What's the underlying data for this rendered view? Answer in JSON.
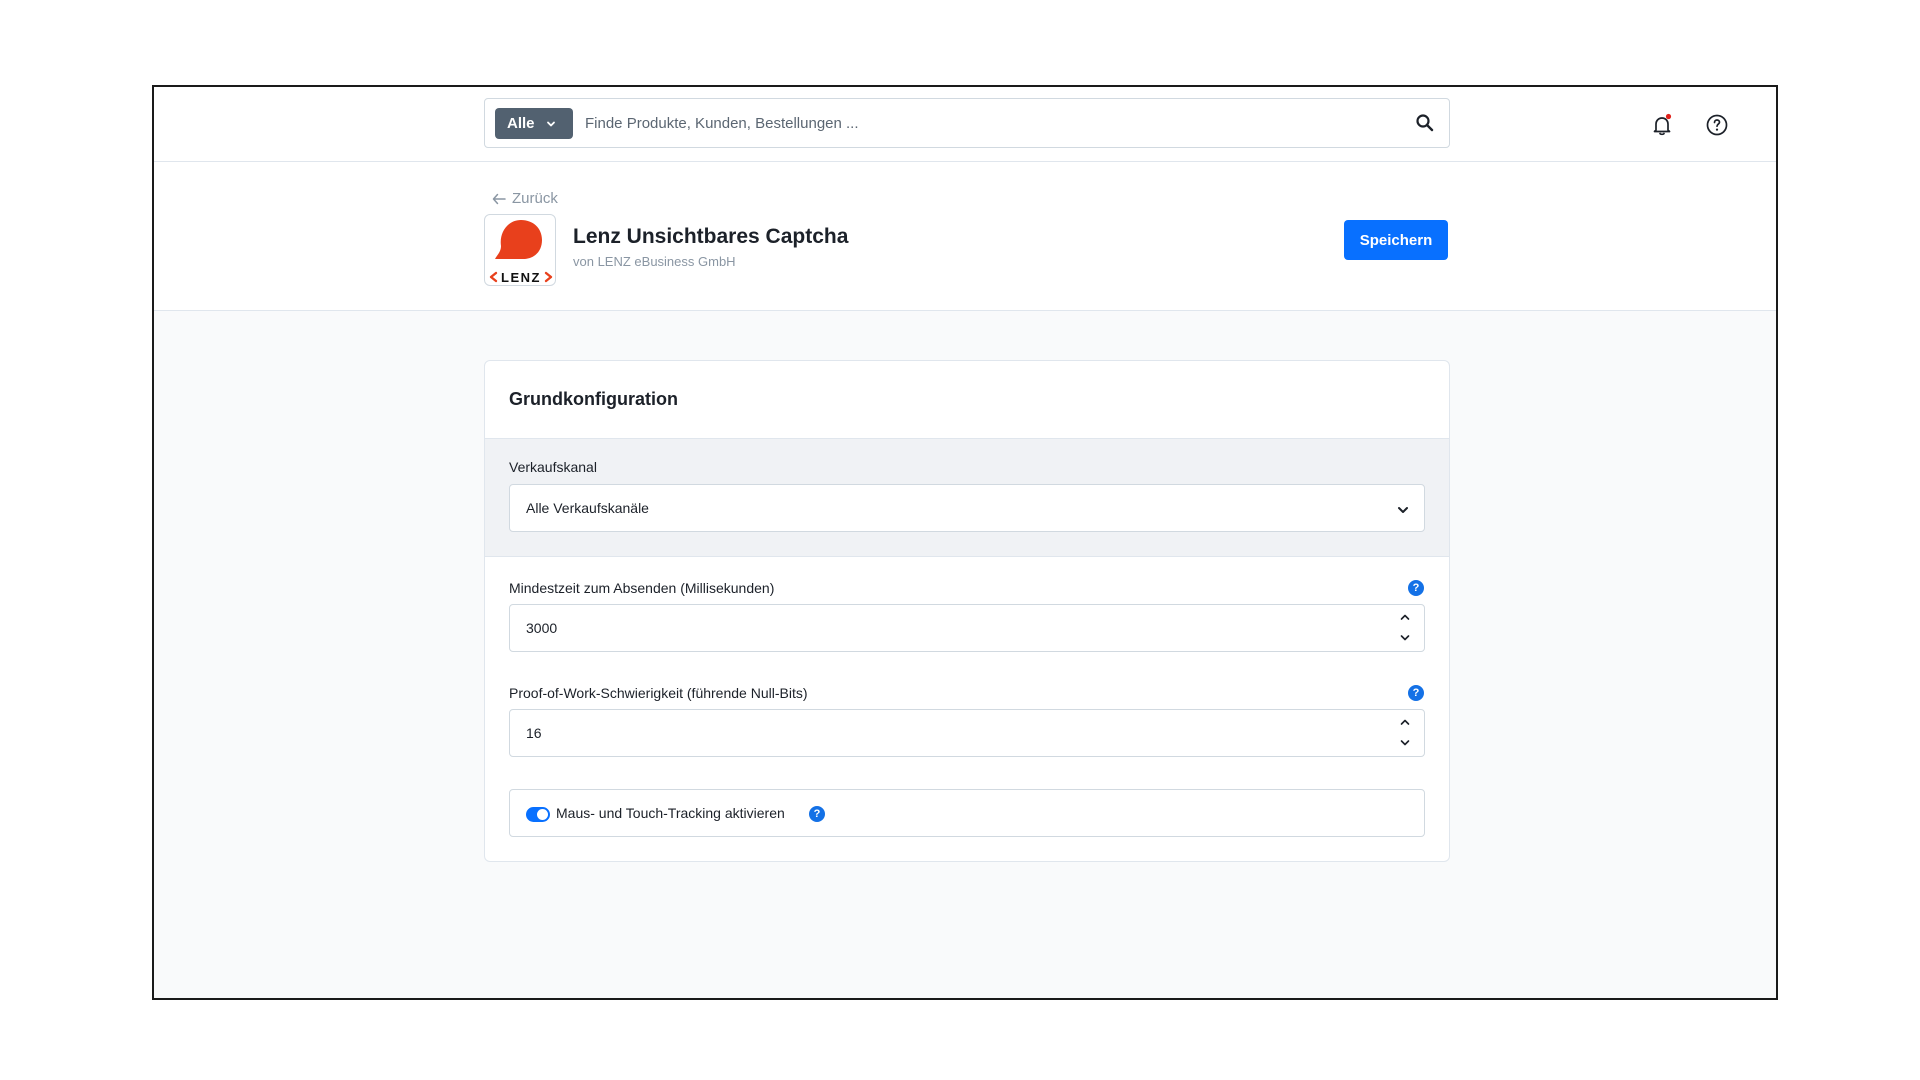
{
  "search": {
    "type_label": "Alle",
    "placeholder": "Finde Produkte, Kunden, Bestellungen ..."
  },
  "header": {
    "back_label": "Zurück",
    "app_title": "Lenz Unsichtbares Captcha",
    "app_vendor": "von LENZ eBusiness GmbH",
    "logo_text": "LENZ",
    "save_label": "Speichern"
  },
  "card": {
    "title": "Grundkonfiguration",
    "sales_channel": {
      "label": "Verkaufskanal",
      "value": "Alle Verkaufskanäle"
    },
    "min_time": {
      "label": "Mindestzeit zum Absenden (Millisekunden)",
      "value": "3000"
    },
    "pow_difficulty": {
      "label": "Proof-of-Work-Schwierigkeit (führende Null-Bits)",
      "value": "16"
    },
    "tracking": {
      "label": "Maus- und Touch-Tracking aktivieren",
      "enabled": true
    },
    "help_glyph": "?"
  },
  "colors": {
    "primary": "#0870ff",
    "logo_red": "#e8401c",
    "search_type_bg": "#526170",
    "notification_dot": "#e0211b"
  }
}
